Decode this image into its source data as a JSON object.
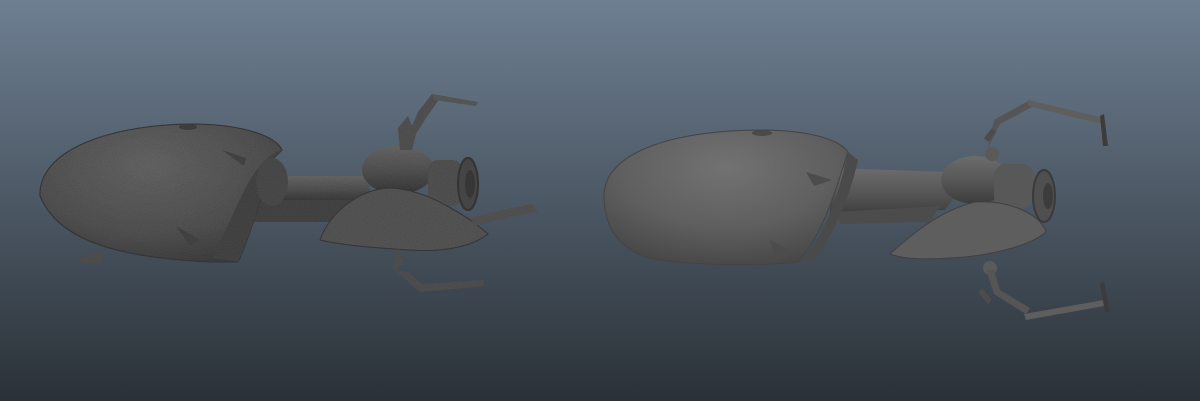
{
  "viewport": {
    "background_top": "#6e7f92",
    "background_bottom": "#2a3137",
    "shade_color": "#5c5c5c"
  },
  "models": [
    {
      "id": "scanned-model",
      "surface": "rough"
    },
    {
      "id": "retopologized-model",
      "surface": "smooth"
    }
  ]
}
